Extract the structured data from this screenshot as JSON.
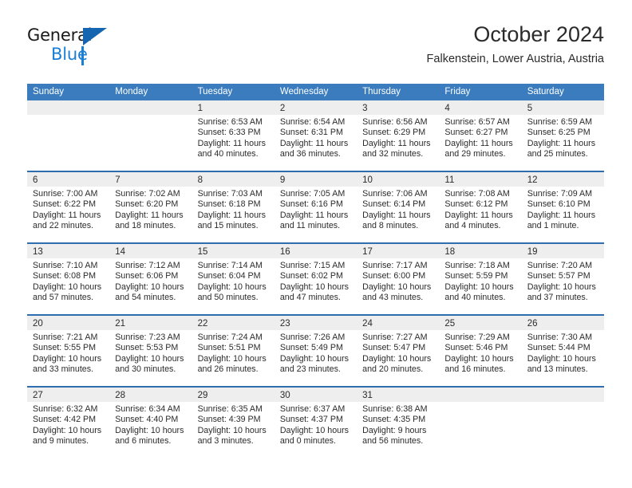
{
  "brand": {
    "name_primary": "General",
    "name_secondary": "Blue",
    "logo_icon": "triangle-logo-icon"
  },
  "header": {
    "title": "October 2024",
    "subtitle": "Falkenstein, Lower Austria, Austria"
  },
  "colors": {
    "header_blue": "#3a7cbe",
    "row_border_blue": "#2f6daf",
    "day_band_gray": "#eeeeee",
    "brand_blue": "#1a7fd4",
    "text": "#2b2b2b"
  },
  "weekdays": [
    "Sunday",
    "Monday",
    "Tuesday",
    "Wednesday",
    "Thursday",
    "Friday",
    "Saturday"
  ],
  "weeks": [
    [
      {
        "empty": true
      },
      {
        "empty": true
      },
      {
        "day": "1",
        "sunrise": "Sunrise: 6:53 AM",
        "sunset": "Sunset: 6:33 PM",
        "daylight1": "Daylight: 11 hours",
        "daylight2": "and 40 minutes."
      },
      {
        "day": "2",
        "sunrise": "Sunrise: 6:54 AM",
        "sunset": "Sunset: 6:31 PM",
        "daylight1": "Daylight: 11 hours",
        "daylight2": "and 36 minutes."
      },
      {
        "day": "3",
        "sunrise": "Sunrise: 6:56 AM",
        "sunset": "Sunset: 6:29 PM",
        "daylight1": "Daylight: 11 hours",
        "daylight2": "and 32 minutes."
      },
      {
        "day": "4",
        "sunrise": "Sunrise: 6:57 AM",
        "sunset": "Sunset: 6:27 PM",
        "daylight1": "Daylight: 11 hours",
        "daylight2": "and 29 minutes."
      },
      {
        "day": "5",
        "sunrise": "Sunrise: 6:59 AM",
        "sunset": "Sunset: 6:25 PM",
        "daylight1": "Daylight: 11 hours",
        "daylight2": "and 25 minutes."
      }
    ],
    [
      {
        "day": "6",
        "sunrise": "Sunrise: 7:00 AM",
        "sunset": "Sunset: 6:22 PM",
        "daylight1": "Daylight: 11 hours",
        "daylight2": "and 22 minutes."
      },
      {
        "day": "7",
        "sunrise": "Sunrise: 7:02 AM",
        "sunset": "Sunset: 6:20 PM",
        "daylight1": "Daylight: 11 hours",
        "daylight2": "and 18 minutes."
      },
      {
        "day": "8",
        "sunrise": "Sunrise: 7:03 AM",
        "sunset": "Sunset: 6:18 PM",
        "daylight1": "Daylight: 11 hours",
        "daylight2": "and 15 minutes."
      },
      {
        "day": "9",
        "sunrise": "Sunrise: 7:05 AM",
        "sunset": "Sunset: 6:16 PM",
        "daylight1": "Daylight: 11 hours",
        "daylight2": "and 11 minutes."
      },
      {
        "day": "10",
        "sunrise": "Sunrise: 7:06 AM",
        "sunset": "Sunset: 6:14 PM",
        "daylight1": "Daylight: 11 hours",
        "daylight2": "and 8 minutes."
      },
      {
        "day": "11",
        "sunrise": "Sunrise: 7:08 AM",
        "sunset": "Sunset: 6:12 PM",
        "daylight1": "Daylight: 11 hours",
        "daylight2": "and 4 minutes."
      },
      {
        "day": "12",
        "sunrise": "Sunrise: 7:09 AM",
        "sunset": "Sunset: 6:10 PM",
        "daylight1": "Daylight: 11 hours",
        "daylight2": "and 1 minute."
      }
    ],
    [
      {
        "day": "13",
        "sunrise": "Sunrise: 7:10 AM",
        "sunset": "Sunset: 6:08 PM",
        "daylight1": "Daylight: 10 hours",
        "daylight2": "and 57 minutes."
      },
      {
        "day": "14",
        "sunrise": "Sunrise: 7:12 AM",
        "sunset": "Sunset: 6:06 PM",
        "daylight1": "Daylight: 10 hours",
        "daylight2": "and 54 minutes."
      },
      {
        "day": "15",
        "sunrise": "Sunrise: 7:14 AM",
        "sunset": "Sunset: 6:04 PM",
        "daylight1": "Daylight: 10 hours",
        "daylight2": "and 50 minutes."
      },
      {
        "day": "16",
        "sunrise": "Sunrise: 7:15 AM",
        "sunset": "Sunset: 6:02 PM",
        "daylight1": "Daylight: 10 hours",
        "daylight2": "and 47 minutes."
      },
      {
        "day": "17",
        "sunrise": "Sunrise: 7:17 AM",
        "sunset": "Sunset: 6:00 PM",
        "daylight1": "Daylight: 10 hours",
        "daylight2": "and 43 minutes."
      },
      {
        "day": "18",
        "sunrise": "Sunrise: 7:18 AM",
        "sunset": "Sunset: 5:59 PM",
        "daylight1": "Daylight: 10 hours",
        "daylight2": "and 40 minutes."
      },
      {
        "day": "19",
        "sunrise": "Sunrise: 7:20 AM",
        "sunset": "Sunset: 5:57 PM",
        "daylight1": "Daylight: 10 hours",
        "daylight2": "and 37 minutes."
      }
    ],
    [
      {
        "day": "20",
        "sunrise": "Sunrise: 7:21 AM",
        "sunset": "Sunset: 5:55 PM",
        "daylight1": "Daylight: 10 hours",
        "daylight2": "and 33 minutes."
      },
      {
        "day": "21",
        "sunrise": "Sunrise: 7:23 AM",
        "sunset": "Sunset: 5:53 PM",
        "daylight1": "Daylight: 10 hours",
        "daylight2": "and 30 minutes."
      },
      {
        "day": "22",
        "sunrise": "Sunrise: 7:24 AM",
        "sunset": "Sunset: 5:51 PM",
        "daylight1": "Daylight: 10 hours",
        "daylight2": "and 26 minutes."
      },
      {
        "day": "23",
        "sunrise": "Sunrise: 7:26 AM",
        "sunset": "Sunset: 5:49 PM",
        "daylight1": "Daylight: 10 hours",
        "daylight2": "and 23 minutes."
      },
      {
        "day": "24",
        "sunrise": "Sunrise: 7:27 AM",
        "sunset": "Sunset: 5:47 PM",
        "daylight1": "Daylight: 10 hours",
        "daylight2": "and 20 minutes."
      },
      {
        "day": "25",
        "sunrise": "Sunrise: 7:29 AM",
        "sunset": "Sunset: 5:46 PM",
        "daylight1": "Daylight: 10 hours",
        "daylight2": "and 16 minutes."
      },
      {
        "day": "26",
        "sunrise": "Sunrise: 7:30 AM",
        "sunset": "Sunset: 5:44 PM",
        "daylight1": "Daylight: 10 hours",
        "daylight2": "and 13 minutes."
      }
    ],
    [
      {
        "day": "27",
        "sunrise": "Sunrise: 6:32 AM",
        "sunset": "Sunset: 4:42 PM",
        "daylight1": "Daylight: 10 hours",
        "daylight2": "and 9 minutes."
      },
      {
        "day": "28",
        "sunrise": "Sunrise: 6:34 AM",
        "sunset": "Sunset: 4:40 PM",
        "daylight1": "Daylight: 10 hours",
        "daylight2": "and 6 minutes."
      },
      {
        "day": "29",
        "sunrise": "Sunrise: 6:35 AM",
        "sunset": "Sunset: 4:39 PM",
        "daylight1": "Daylight: 10 hours",
        "daylight2": "and 3 minutes."
      },
      {
        "day": "30",
        "sunrise": "Sunrise: 6:37 AM",
        "sunset": "Sunset: 4:37 PM",
        "daylight1": "Daylight: 10 hours",
        "daylight2": "and 0 minutes."
      },
      {
        "day": "31",
        "sunrise": "Sunrise: 6:38 AM",
        "sunset": "Sunset: 4:35 PM",
        "daylight1": "Daylight: 9 hours",
        "daylight2": "and 56 minutes."
      },
      {
        "empty": true
      },
      {
        "empty": true
      }
    ]
  ]
}
